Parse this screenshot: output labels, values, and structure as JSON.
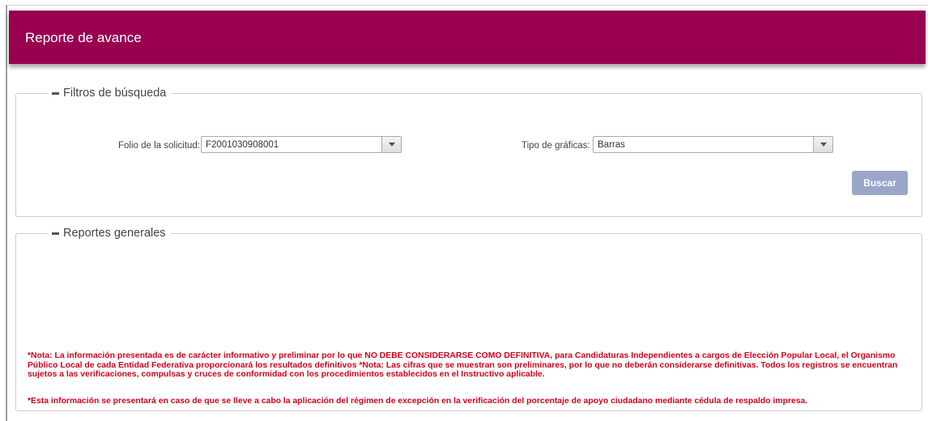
{
  "header": {
    "title": "Reporte de avance"
  },
  "filtros": {
    "legend": "Filtros de búsqueda",
    "folio_label": "Folio de la solicitud:",
    "folio_value": "F2001030908001",
    "tipo_label": "Tipo de gráficas:",
    "tipo_value": "Barras",
    "buscar_label": "Buscar"
  },
  "reportes": {
    "legend": "Reportes generales",
    "note1": "*Nota: La información presentada es de carácter informativo y preliminar por lo que NO DEBE CONSIDERARSE COMO DEFINITIVA, para Candidaturas Independientes a cargos de Elección Popular Local, el Organismo Público Local de cada Entidad Federativa proporcionará los resultados definitivos *Nota: Las cifras que se muestran son preliminares, por lo que no deberán considerarse definitivas. Todos los registros se encuentran sujetos a las verificaciones, compulsas y cruces de conformidad con los procedimientos establecidos en el Instructivo aplicable.",
    "note2": "*Esta información se presentará en caso de que se lleve a cabo la aplicación del régimen de excepción en la verificación del porcentaje de apoyo ciudadano mediante cédula de respaldo impresa."
  },
  "colors": {
    "header_bg": "#990050",
    "button_bg": "#9aa6c9",
    "note_text": "#d0021b"
  },
  "icons": {
    "dropdown": "chevron-down-icon",
    "legend_toggle": "minus-icon"
  }
}
